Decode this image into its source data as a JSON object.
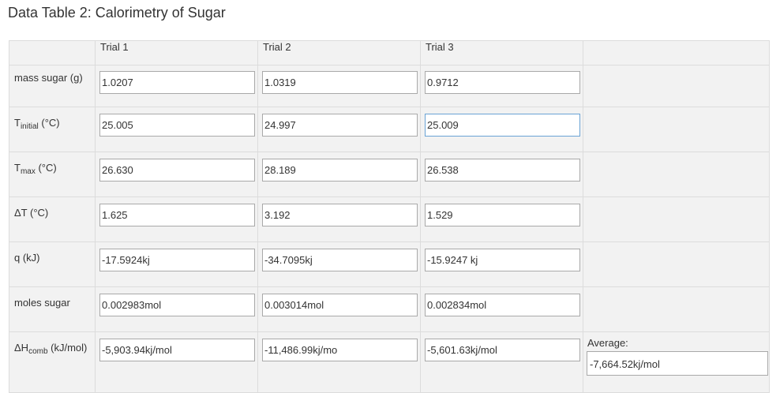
{
  "title": "Data Table 2: Calorimetry of Sugar",
  "columns": [
    "Trial 1",
    "Trial 2",
    "Trial 3"
  ],
  "rows": [
    {
      "label": "mass sugar (g)",
      "values": [
        "1.0207",
        "1.0319",
        "0.9712"
      ]
    },
    {
      "label_main": "T",
      "label_sub": "initial",
      "label_unit": " (°C)",
      "values": [
        "25.005",
        "24.997",
        "25.009"
      ]
    },
    {
      "label_main": "T",
      "label_sub": "max",
      "label_unit": " (°C)",
      "values": [
        "26.630",
        "28.189",
        "26.538"
      ]
    },
    {
      "label": "ΔT (°C)",
      "values": [
        "1.625",
        "3.192",
        "1.529"
      ]
    },
    {
      "label": "q (kJ)",
      "values": [
        "-17.5924kj",
        "-34.7095kj",
        "-15.9247 kj"
      ]
    },
    {
      "label": "moles sugar",
      "values": [
        "0.002983mol",
        "0.003014mol",
        "0.002834mol"
      ]
    },
    {
      "label_main": "ΔH",
      "label_sub": "comb",
      "label_unit": " (kJ/mol)",
      "values": [
        "-5,903.94kj/mol",
        "-11,486.99kj/mo",
        "-5,601.63kj/mol"
      ]
    }
  ],
  "average": {
    "label": "Average:",
    "value": "-7,664.52kj/mol"
  }
}
